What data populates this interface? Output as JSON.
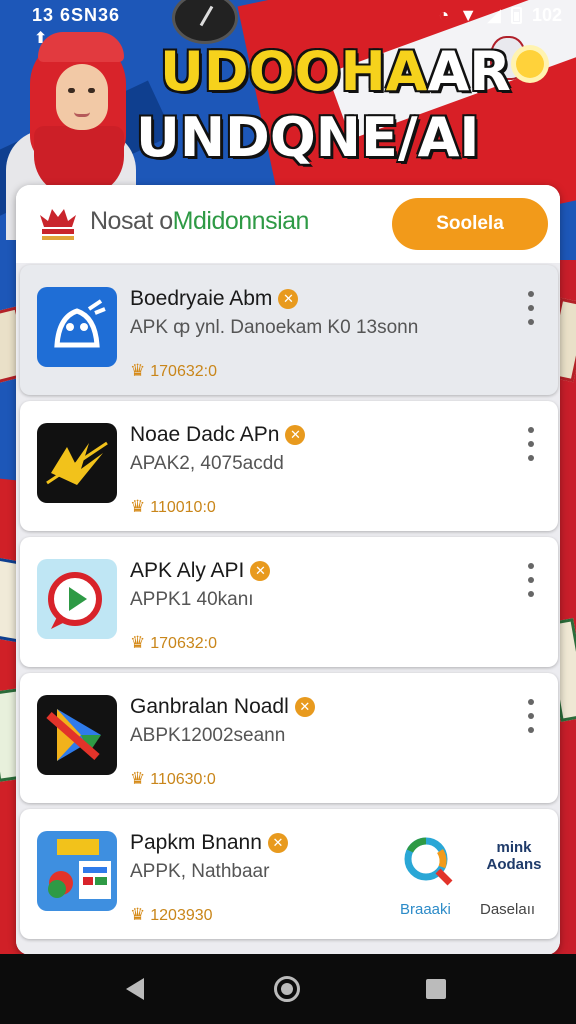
{
  "status_bar": {
    "left_text": "13 6SN36",
    "battery": "102"
  },
  "headline": {
    "line1_yellow": "UDOOHA",
    "line1_white": "AR",
    "line2": "UNDQNE/AI"
  },
  "header": {
    "brand_prefix": "Nosat o",
    "brand_green": "Mdidonnsian",
    "search_label": "Soolela"
  },
  "apps": [
    {
      "title": "Boedryaie Abm",
      "subtitle": "APK ȹ ynl. Danoekam  K0 13sonn",
      "count": "170632:0"
    },
    {
      "title": "Noae Dadc APn",
      "subtitle": "APAK2, 4075acdd",
      "count": "110010:0"
    },
    {
      "title": "APK Aly API",
      "subtitle": "APPK1 40kanı",
      "count": "170632:0"
    },
    {
      "title": "Ganbralan Noadl",
      "subtitle": "ABPK12002seann",
      "count": "110630:0"
    },
    {
      "title": "Papkm Bnann",
      "subtitle": "APPK, Nathbaar",
      "count": "1203930"
    }
  ],
  "side_widgets": {
    "widget2_text_line1": "mink",
    "widget2_text_line2": "Aodans",
    "label1": "Braaaki",
    "label2": "Daselaıı"
  },
  "colors": {
    "accent_orange": "#f29a1a",
    "brand_green": "#2e9a45",
    "headline_yellow": "#f6d21c",
    "background_blue": "#1d57b8",
    "background_red": "#d81f26"
  },
  "icons": {
    "verified": "verified-badge-icon",
    "count": "crown-icon",
    "menu": "kebab-menu-icon"
  }
}
